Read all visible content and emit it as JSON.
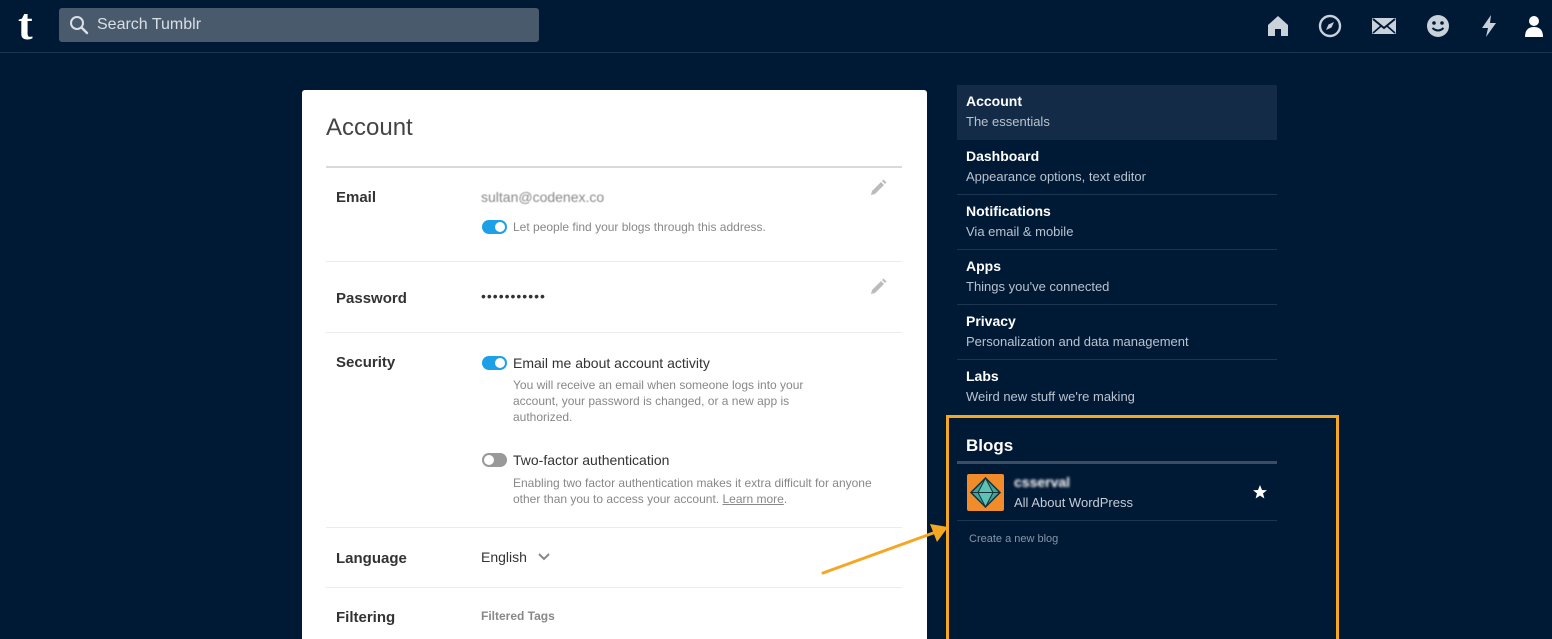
{
  "app": {
    "logo": "t"
  },
  "search": {
    "placeholder": "Search Tumblr"
  },
  "nav": {
    "icons": [
      "home-icon",
      "compass-icon",
      "mail-icon",
      "smiley-icon",
      "lightning-icon",
      "person-icon"
    ]
  },
  "account": {
    "title": "Account",
    "email": {
      "label": "Email",
      "value": "sultan@codenex.co",
      "toggle_on": true,
      "toggle_text": "Let people find your blogs through this address."
    },
    "password": {
      "label": "Password",
      "value": "•••••••••••"
    },
    "security": {
      "label": "Security",
      "activity": {
        "toggle_on": true,
        "label": "Email me about account activity",
        "hint": "You will receive an email when someone logs into your account, your password is changed, or a new app is authorized."
      },
      "two_factor": {
        "toggle_on": false,
        "label": "Two-factor authentication",
        "hint": "Enabling two factor authentication makes it extra difficult for anyone other than you to access your account.",
        "link": "Learn more"
      }
    },
    "language": {
      "label": "Language",
      "value": "English"
    },
    "filtering": {
      "label": "Filtering",
      "sub_label": "Filtered Tags"
    }
  },
  "sidebar": {
    "items": [
      {
        "title": "Account",
        "sub": "The essentials",
        "active": true
      },
      {
        "title": "Dashboard",
        "sub": "Appearance options, text editor"
      },
      {
        "title": "Notifications",
        "sub": "Via email & mobile"
      },
      {
        "title": "Apps",
        "sub": "Things you've connected"
      },
      {
        "title": "Privacy",
        "sub": "Personalization and data management"
      },
      {
        "title": "Labs",
        "sub": "Weird new stuff we're making"
      }
    ]
  },
  "blogs": {
    "title": "Blogs",
    "items": [
      {
        "name": "csserval",
        "sub": "All About WordPress"
      }
    ],
    "create": "Create a new blog"
  },
  "colors": {
    "background": "#001935",
    "accent": "#1ea0e8",
    "highlight": "#f5a623",
    "avatar": "#f08c2a"
  }
}
